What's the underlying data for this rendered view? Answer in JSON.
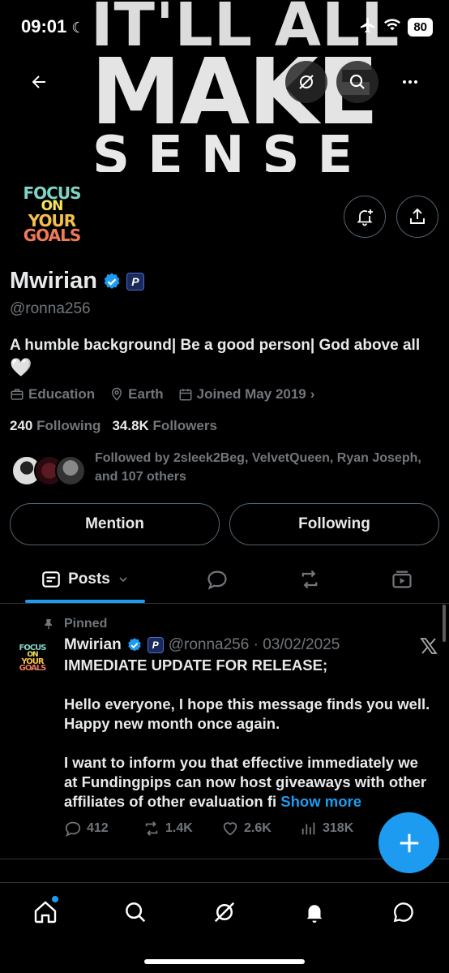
{
  "status_bar": {
    "time": "09:01",
    "battery": "80"
  },
  "banner": {
    "line1": "IT'LL ALL",
    "line2": "MAKE",
    "line3": "SENSE"
  },
  "avatar": {
    "words": [
      "FOCUS",
      "ON",
      "YOUR",
      "GOALS"
    ]
  },
  "profile": {
    "name": "Mwirian",
    "handle": "@ronna256",
    "bio_line1": "A humble background| Be a good person| God above all",
    "bio_line2": "🤍",
    "category": "Education",
    "location": "Earth",
    "joined": "Joined May 2019",
    "following_count": "240",
    "following_label": "Following",
    "followers_count": "34.8K",
    "followers_label": "Followers",
    "followed_by": "Followed by 2sleek2Beg, VelvetQueen, Ryan Joseph, and 107 others"
  },
  "buttons": {
    "mention": "Mention",
    "following": "Following"
  },
  "tabs": {
    "posts": "Posts"
  },
  "post": {
    "pinned": "Pinned",
    "author": "Mwirian",
    "handle_date": "@ronna256 · 03/02/2025",
    "line1": "IMMEDIATE UPDATE FOR RELEASE;",
    "para2": "Hello everyone, I hope this message finds you well. Happy new month once again.",
    "para3": "I want to inform you that effective immediately we at Fundingpips can now host giveaways with other affiliates of other evaluation fi",
    "show_more": "Show more",
    "replies": "412",
    "reposts": "1.4K",
    "likes": "2.6K",
    "views": "318K"
  },
  "colors": {
    "accent": "#1d9bf0",
    "muted": "#71767b",
    "border": "#2f3336"
  }
}
